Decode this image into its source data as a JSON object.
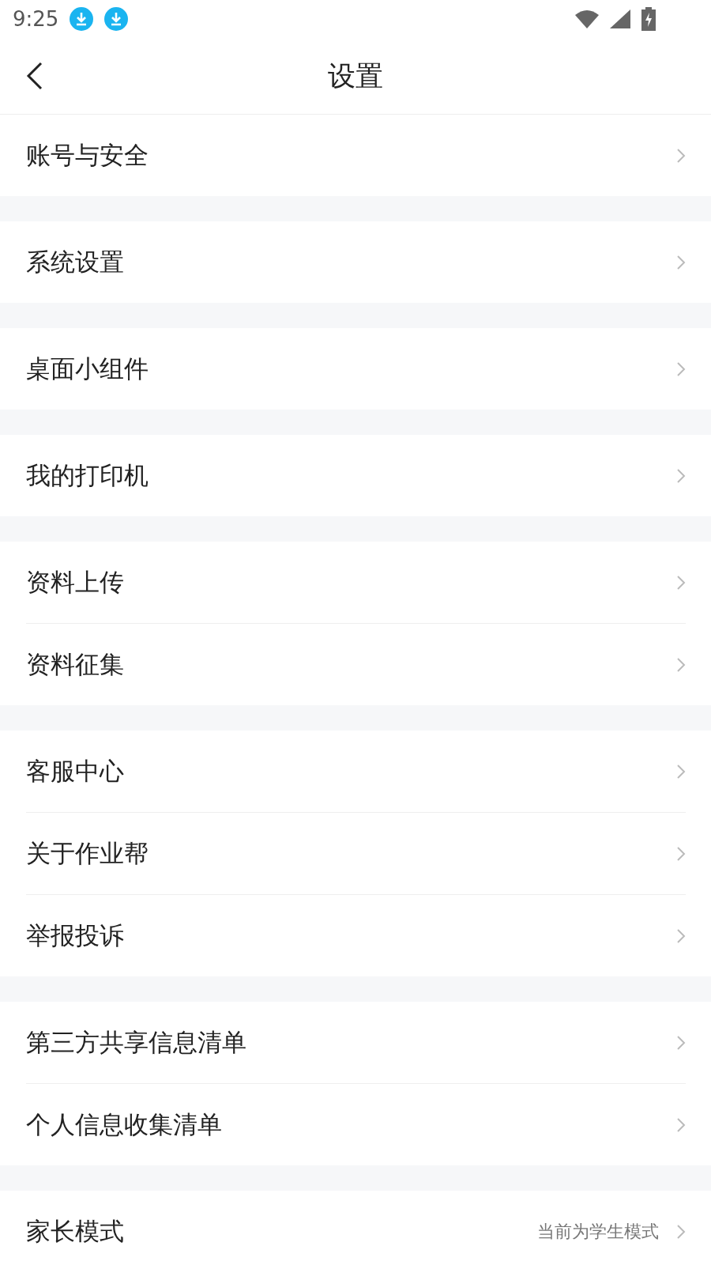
{
  "status_bar": {
    "time": "9:25"
  },
  "header": {
    "title": "设置"
  },
  "groups": [
    {
      "items": [
        {
          "label": "账号与安全"
        }
      ]
    },
    {
      "items": [
        {
          "label": "系统设置"
        }
      ]
    },
    {
      "items": [
        {
          "label": "桌面小组件"
        }
      ]
    },
    {
      "items": [
        {
          "label": "我的打印机"
        }
      ]
    },
    {
      "items": [
        {
          "label": "资料上传"
        },
        {
          "label": "资料征集"
        }
      ]
    },
    {
      "items": [
        {
          "label": "客服中心"
        },
        {
          "label": "关于作业帮"
        },
        {
          "label": "举报投诉"
        }
      ]
    },
    {
      "items": [
        {
          "label": "第三方共享信息清单"
        },
        {
          "label": "个人信息收集清单"
        }
      ]
    },
    {
      "items": [
        {
          "label": "家长模式",
          "value": "当前为学生模式"
        }
      ]
    }
  ]
}
